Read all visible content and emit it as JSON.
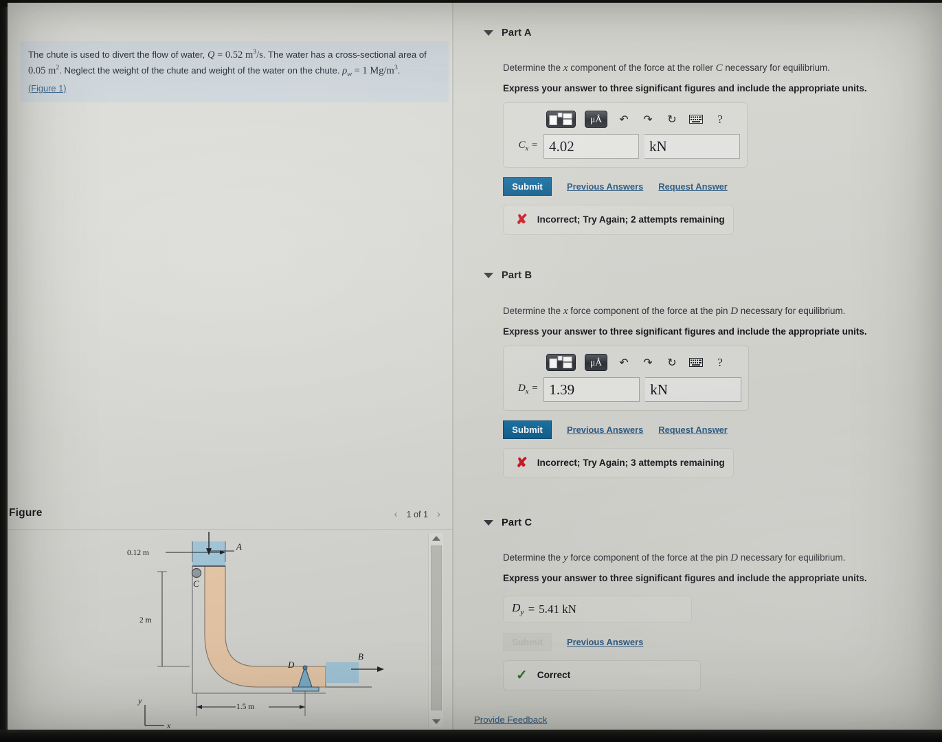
{
  "problem": {
    "text_1": "The chute is used to divert the flow of water,",
    "q_symbol": "Q",
    "q_eq": "= 0.52",
    "q_units_base": "m",
    "q_units_sup": "3",
    "q_units_den": "/s",
    "text_2": ". The water has a cross-sectional area of",
    "area_value": "0.05",
    "area_units_base": "m",
    "area_units_sup": "2",
    "text_3": ". Neglect the weight of the chute and weight of the water on the chute.",
    "rho_symbol": "ρ",
    "rho_sub": "w",
    "rho_eq": "= 1",
    "rho_units_base": "Mg/m",
    "rho_units_sup": "3",
    "period": ".",
    "figure_link": "(Figure 1)"
  },
  "figure_panel": {
    "title": "Figure",
    "prev_arrow": "‹",
    "page_count": "1 of 1",
    "next_arrow": "›",
    "diagram": {
      "label_a": "A",
      "label_b": "B",
      "label_c": "C",
      "label_d": "D",
      "dim_top": "0.12 m",
      "dim_left": "2 m",
      "dim_bottom": "1.5 m",
      "axis_y": "y",
      "axis_x": "x"
    }
  },
  "parts": [
    {
      "id": "part-a",
      "label": "Part A",
      "prompt_pre": "Determine the ",
      "prompt_var": "x",
      "prompt_post": " component of the force at the roller ",
      "prompt_var2": "C",
      "prompt_tail": " necessary for equilibrium.",
      "instruction": "Express your answer to three significant figures and include the appropriate units.",
      "answer_variable": "C",
      "answer_subscript": "x",
      "answer_equals": "=",
      "answer_value": "4.02",
      "answer_units": "kN",
      "toolbar": {
        "template_label": "template-icon",
        "units_label": "μÅ",
        "undo": "↶",
        "redo": "↷",
        "reset": "↻",
        "keyboard": "⌨",
        "help": "?"
      },
      "submit_label": "Submit",
      "submit_disabled": false,
      "previous_answers_label": "Previous Answers",
      "request_answer_label": "Request Answer",
      "show_request_answer": true,
      "banner_icon": "cross-icon",
      "banner_text": "Incorrect; Try Again; 2 attempts remaining"
    },
    {
      "id": "part-b",
      "label": "Part B",
      "prompt_pre": "Determine the ",
      "prompt_var": "x",
      "prompt_post": " force component of the force at the pin ",
      "prompt_var2": "D",
      "prompt_tail": " necessary for equilibrium.",
      "instruction": "Express your answer to three significant figures and include the appropriate units.",
      "answer_variable": "D",
      "answer_subscript": "x",
      "answer_equals": "=",
      "answer_value": "1.39",
      "answer_units": "kN",
      "toolbar": {
        "template_label": "template-icon",
        "units_label": "μÅ",
        "undo": "↶",
        "redo": "↷",
        "reset": "↻",
        "keyboard": "⌨",
        "help": "?"
      },
      "submit_label": "Submit",
      "submit_disabled": false,
      "previous_answers_label": "Previous Answers",
      "request_answer_label": "Request Answer",
      "show_request_answer": true,
      "banner_icon": "cross-icon",
      "banner_text": "Incorrect; Try Again; 3 attempts remaining"
    },
    {
      "id": "part-c",
      "label": "Part C",
      "prompt_pre": "Determine the ",
      "prompt_var": "y",
      "prompt_post": " force component of the force at the pin ",
      "prompt_var2": "D",
      "prompt_tail": " necessary for equilibrium.",
      "instruction": "Express your answer to three significant figures and include the appropriate units.",
      "answer_variable": "D",
      "answer_subscript": "y",
      "answer_equals": "=",
      "answer_value": "5.41 kN",
      "submit_label": "Submit",
      "submit_disabled": true,
      "previous_answers_label": "Previous Answers",
      "show_request_answer": false,
      "banner_icon": "check-icon",
      "banner_text": "Correct"
    }
  ],
  "footer": {
    "provide_feedback": "Provide Feedback"
  },
  "colors": {
    "submit_blue": "#14618f",
    "link_blue": "#2f5d86",
    "incorrect_red": "#cf1b28",
    "correct_green": "#2a7a2f",
    "highlight_blue": "#cfd7dc",
    "chute_tan": "#f0cfae",
    "water_blue": "#a9cfe3"
  }
}
